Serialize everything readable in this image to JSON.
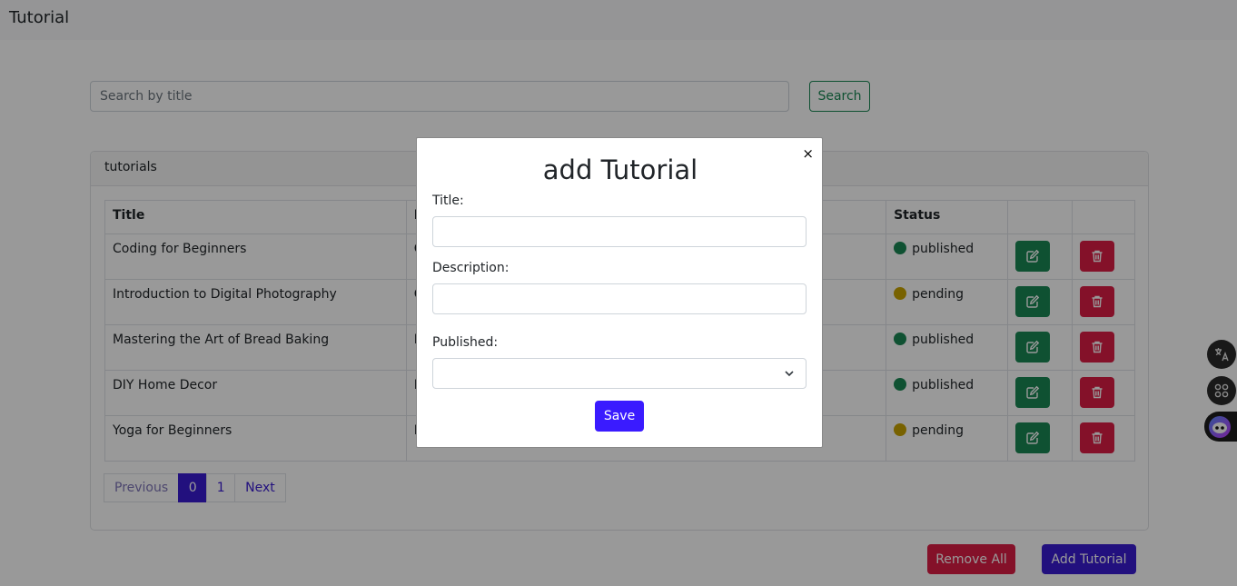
{
  "navbar": {
    "brand": "Tutorial"
  },
  "search": {
    "placeholder": "Search by title",
    "value": "",
    "button_label": "Search"
  },
  "card": {
    "header": "tutorials"
  },
  "table": {
    "headers": [
      "Title",
      "D",
      "Status"
    ],
    "rows": [
      {
        "title": "Coding for Beginners",
        "desc": "C",
        "status": "published",
        "status_color": "#198754"
      },
      {
        "title": "Introduction to Digital Photography",
        "desc": "C",
        "status": "pending",
        "status_color": "#c9a400"
      },
      {
        "title": "Mastering the Art of Bread Baking",
        "desc": "L",
        "status": "published",
        "status_color": "#198754"
      },
      {
        "title": "DIY Home Decor",
        "desc": "F",
        "status": "published",
        "status_color": "#198754"
      },
      {
        "title": "Yoga for Beginners",
        "desc": "B",
        "status": "pending",
        "status_color": "#c9a400"
      }
    ],
    "row_actions": {
      "edit_icon": "edit-icon",
      "delete_icon": "trash-icon"
    }
  },
  "pagination": {
    "previous": "Previous",
    "pages": [
      "0",
      "1"
    ],
    "active_page": "0",
    "next": "Next"
  },
  "actions": {
    "remove_all": "Remove All",
    "add_tutorial": "Add Tutorial"
  },
  "side_toolbar": {
    "icons": [
      "translate-icon",
      "apps-icon",
      "assistant-icon"
    ]
  },
  "modal": {
    "title": "add Tutorial",
    "close": "×",
    "title_label": "Title:",
    "title_value": "",
    "description_label": "Description:",
    "description_value": "",
    "published_label": "Published:",
    "published_value": "",
    "save_label": "Save"
  },
  "colors": {
    "primary": "#3a1bd3",
    "success": "#198754",
    "danger": "#dc1d45",
    "warning": "#c9a400"
  }
}
